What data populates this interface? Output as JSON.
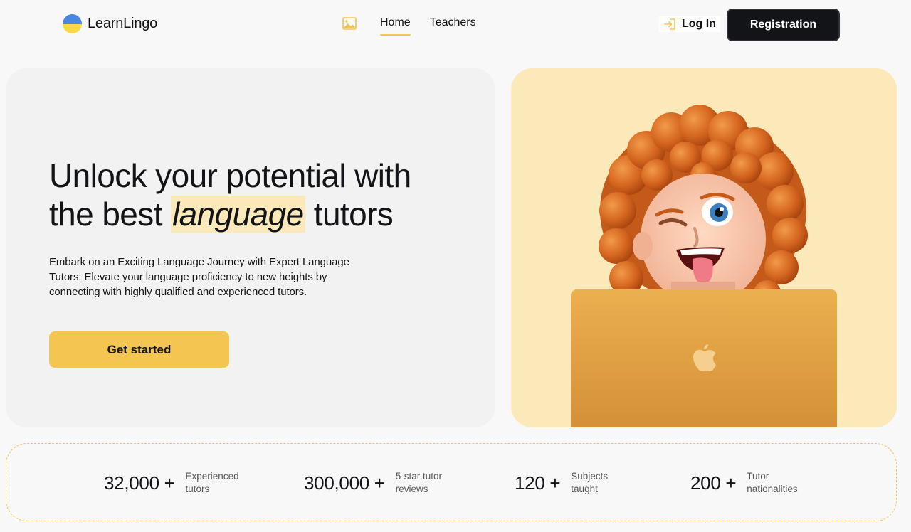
{
  "brand": {
    "name": "LearnLingo",
    "flag_colors": [
      "#4a86e2",
      "#f9d846"
    ]
  },
  "nav": {
    "image_icon": "broken-image-icon",
    "items": [
      {
        "label": "Home",
        "active": true
      },
      {
        "label": "Teachers",
        "active": false
      }
    ]
  },
  "auth": {
    "login_label": "Log In",
    "login_icon": "login-icon",
    "register_label": "Registration"
  },
  "hero": {
    "title_before": "Unlock your potential with the best ",
    "title_highlight": "language",
    "title_after": " tutors",
    "description": "Embark on an Exciting Language Journey with Expert Language Tutors: Elevate your language proficiency to new heights by connecting with highly qualified and experienced tutors.",
    "cta_label": "Get started",
    "image": "memoji-girl-with-laptop",
    "image_brand_icon": "apple-logo-icon"
  },
  "stats": [
    {
      "value": "32,000 +",
      "label": "Experienced tutors"
    },
    {
      "value": "300,000 +",
      "label": "5-star tutor reviews"
    },
    {
      "value": "120 +",
      "label": "Subjects taught"
    },
    {
      "value": "200 +",
      "label": "Tutor nationalities"
    }
  ],
  "colors": {
    "accent": "#f4c550",
    "accent_light": "#fbe9ba",
    "dark": "#121417",
    "card_bg": "#f2f2f2",
    "page_bg": "#f8f8f8"
  }
}
